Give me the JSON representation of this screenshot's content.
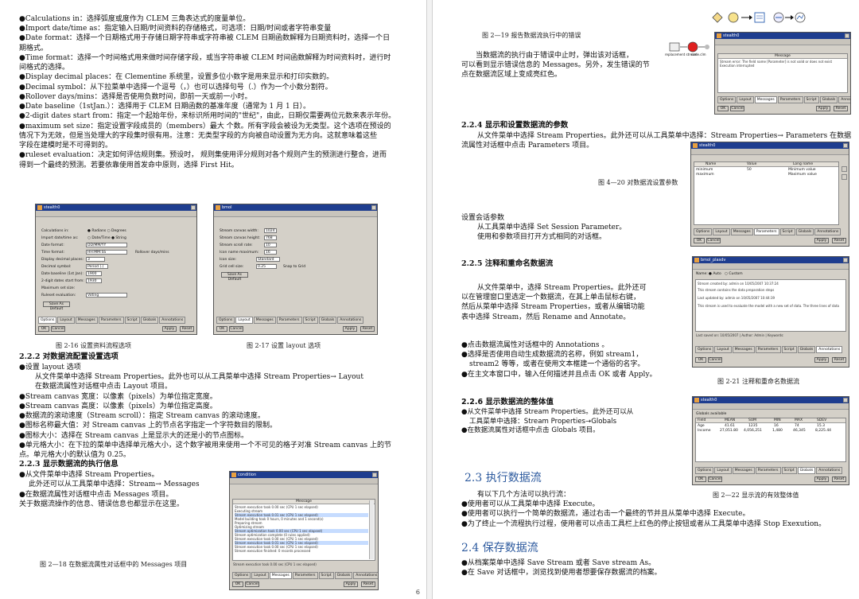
{
  "left_page": {
    "lines": [
      "●Calculations in：选择弧度或度作为 CLEM 三角表达式的度量单位。",
      "●Import date/time as：指定输入日期/时间资料的存储格式，可选项：日期/时间或者字符串变量",
      "●Date format：选择一个日期格式用于存储日期字符串或字符串被 CLEM 日期函数解释为日期资料时，选择一个日",
      "期格式。",
      "●Time format：选择一个时间格式用来做时间存储字段，或当字符串被 CLEM 时间函数解释为时间资料时，进行时",
      "间格式的选择。",
      "●Display decimal places：在 Clementine 系统里，设置多位小数字是用来显示和打印实数的。",
      "●Decimal symbol：从下拉菜单中选择一个逗号（，）也可以选择句号（.）作为一个小数分割符。",
      "●Rollover days/mins：选择是否使用负数时间，即前一天或前一小时。",
      "●Date baseline（1stJan.）：选择用于 CLEM 日期函数的基准年度（通常为 1 月 1 日）。",
      "●2-digit dates start from：指定一个起始年份，来标识所用时间的\"世纪\"，由此，日期仅需要两位元数来表示年份。",
      "●maximum set size：指定设置字段成员的（members）最大 个数。所有字段会被设为无类型。这个选项在预设的",
      "情况下为无效，但是当处理大的字段集时很有用。注意：无类型字段的方向被自动设置为无方向。这就意味着这些",
      "字段在建模时是不可得到的。",
      "●ruleset evaluation：决定如何评估规则集。预设时，     规则集使用评分规则对各个规则产生的预测进行整合，进而",
      "得到一个最终的预测。若要依靠使用首发命中原则，选择 First Hit。"
    ],
    "fig216_caption": "图 2-16    设置资料流程选项",
    "fig217_caption": "图 2-17   设置 layout 选项",
    "section_lines": [
      {
        "text": "2.2.2 对数据流配置设置选项",
        "cls": "heading"
      },
      {
        "text": "●设置 layout 选项",
        "cls": ""
      },
      {
        "text": "从文件菜单中选择 Stream Properties。此外也可以从工具菜单中选择 Stream Properties→ Layout",
        "cls": "indent"
      },
      {
        "text": "在数据流属性对话框中点击 Layout 项目。",
        "cls": "indent"
      },
      {
        "text": "●Stream canvas 宽度：以像素（pixels）为单位指定宽度。",
        "cls": ""
      },
      {
        "text": "●Stream canvas 高度：以像素（pixels）为单位指定高度。",
        "cls": ""
      },
      {
        "text": "●数据流的滚动速度（Stream scroll）：指定 Stream canvas 的滚动速度。",
        "cls": ""
      },
      {
        "text": "●图标名称最大值：对 Stream canvas 上的节点名字指定一个字符数目的限制。",
        "cls": ""
      },
      {
        "text": "●图标大小：选择在 Stream canvas 上是显示大的还是小的节点图标。",
        "cls": ""
      },
      {
        "text": "●单元格大小：在下拉的菜单中选择单元格大小，这个数字被用来使用一个不可见的格子对准 Stream canvas 上的节",
        "cls": ""
      },
      {
        "text": "点。单元格大小的默认值为 0.25。",
        "cls": ""
      },
      {
        "text": "2.2.3 显示数据流的执行信息",
        "cls": "heading"
      },
      {
        "text": "●从文件菜单中选择 Stream Properties。",
        "cls": ""
      },
      {
        "text": "此外还可以从工具菜单中选择：Stream→ Messages",
        "cls": "indent-small"
      },
      {
        "text": "●在数据流属性对话框中点击 Messages 项目。",
        "cls": ""
      },
      {
        "text": "关于数据流操作的信息、错误信息也都显示在这里。",
        "cls": ""
      }
    ],
    "fig218_caption": "图 2—18    在数据流属性对话框中的 Messages 项目",
    "page_number": "6"
  },
  "right_page": {
    "fig219_caption": "图 2—19    报告数据流执行中的错误",
    "error_para": [
      "当数据流的执行由于错误中止时，弹出该对话框，",
      "可以看到显示错误信息的 Messages。另外，发生错误的节",
      "点在数据流区域上变成亮红色。"
    ],
    "sec224_heading": "2.2.4 显示和设置数据流的参数",
    "sec224_lines": [
      "从文件菜单中选择 Stream Properties。此外还可以从工具菜单中选择：Stream Properties→  Parameters     在数据",
      "流属性对话框中点击 Parameters 项目。"
    ],
    "fig220_caption": "图 4—20   对数据流设置参数",
    "session_lines": [
      "设置会话参数",
      "从工具菜单中选择 Set Session Parameter。",
      "使用和参数项目打开方式相同的对话框。"
    ],
    "sec225_heading": "2.2.5 注释和重命名数据流",
    "sec225_lines": [
      "从文件菜单中，选择 Stream Properties。此外还可",
      "以在管理窗口里选定一个数据流，在其上单击鼠标右键，",
      "然后从菜单中选择 Stream Properties，或者从编辑功能",
      "表中选择 Stream，然后 Rename and Annotate。"
    ],
    "sec225_bullets": [
      "●点击数据流属性对话框中的 Annotations 。",
      "●选择是否使用自动生成数据流的名称，例如    stream1，",
      "stream2 等等，或者在使用文本框建一个通俗的名字。",
      "●在主文本窗口中，输入任何描述并且点击 OK 或者 Apply。"
    ],
    "fig221_caption": "图 2-21 注释和重命名数据流",
    "sec226_heading": "2.2.6 显示数据流的整体值",
    "sec226_lines": [
      "●从文件菜单中选择 Stream Properties。此外还可以从",
      "工具菜单中选择：Stream Properties→Globals",
      "●在数据流属性对话框中点击 Globals 项目。"
    ],
    "sec23_heading": "2.3   执行数据流",
    "sec23_lines": [
      "有以下几个方法可以执行流：",
      "●使用者可以从工具菜单中选择 Execute。",
      "●使用者可以执行一个简单的数据流，通过右击一个最终的节并且从菜单中选择 Execute。",
      "●为了终止一个流程执行过程，使用者可以点击工具栏上红色的停止按钮或者从工具菜单中选择 Stop Exexution。"
    ],
    "fig222_caption": "图 2—22   显示流的有效整体值",
    "sec24_heading": "2.4   保存数据流",
    "sec24_lines": [
      "●从档案菜单中选择 Save Stream 或者 Save stream As。",
      "●在 Save 对话框中，浏览找到使用者想要保存数据流的档案。"
    ]
  },
  "dialogs": {
    "fig216": {
      "title": "stealth0",
      "rows": [
        "Calculations in:",
        "Import date/time as:",
        "Date format:",
        "Time format:",
        "Display decimal places:",
        "Decimal symbol:",
        "Date baseline (1st Jan):",
        "2-digit dates start from:",
        "Maximum set size:",
        "Ruleset evaluation:",
        "Save As Default"
      ],
      "values": [
        "● Radians   ○ Degrees",
        "○ Date/Time  ● String",
        "DD/MM/YY",
        "HH:MM:SS",
        "3",
        "Period (.)",
        "1900",
        "1930",
        "",
        "Voting",
        ""
      ],
      "rollover": "Rollover days/mins",
      "tabs": [
        "Options",
        "Layout",
        "Messages",
        "Parameters",
        "Script",
        "Globals",
        "Annotations"
      ],
      "ok": "OK",
      "cancel": "Cancel",
      "apply": "Apply",
      "reset": "Reset"
    },
    "fig217": {
      "title": "bmol",
      "rows": [
        "Stream canvas width:",
        "Stream canvas height:",
        "Stream scroll rate:",
        "Icon name maximum:",
        "Icon size:",
        "Grid cell size:",
        "Save As Default"
      ],
      "values": [
        "1024",
        "768",
        "10",
        "16",
        "Standard",
        "0.25",
        ""
      ],
      "snap": "Snap to Grid",
      "tabs": [
        "Options",
        "Layout",
        "Messages",
        "Parameters",
        "Script",
        "Globals",
        "Annotations"
      ],
      "ok": "OK",
      "cancel": "Cancel",
      "apply": "Apply",
      "reset": "Reset"
    },
    "fig218": {
      "title": "condition",
      "header": "Message",
      "messages": [
        "Stream execution took 0.00 sec (CPU 1 sec elapsed)",
        "Executing stream",
        "Stream execution took 0.01 sec (CPU 1 sec elapsed)",
        "Model building took 0 hours, 0 minutes and 1 second(s)",
        "Preparing stream",
        "Optimizing stream",
        "Stream optimization took 0.00 sec (CPU 1 sec elapsed)",
        "Stream optimization complete (0 rules applied)",
        "Stream execution took 0.00 sec (CPU 1 sec elapsed)",
        "Stream execution took 0.01 sec (CPU 1 sec elapsed)",
        "Stream execution took 0.00 sec (CPU 1 sec elapsed)",
        "Stream execution finished: 0 records processed"
      ],
      "status": "Stream execution took 0.00 sec (CPU 1 sec elapsed)",
      "tabs": [
        "Options",
        "Layout",
        "Messages",
        "Parameters",
        "Script",
        "Globals",
        "Annotations"
      ],
      "ok": "OK",
      "cancel": "Cancel",
      "apply": "Apply",
      "reset": "Reset"
    },
    "fig219": {
      "title": "stealth0",
      "header": "Message",
      "messages": [
        "Stream error: The field name [Parameter] is not valid or does not exist",
        "Execution interrupted"
      ],
      "tabs": [
        "Options",
        "Layout",
        "Messages",
        "Parameters",
        "Script",
        "Globals",
        "Annotations"
      ],
      "ok": "OK",
      "cancel": "Cancel",
      "apply": "Apply",
      "reset": "Reset",
      "node_label": "replacement stream",
      "node_label2": "node.clm"
    },
    "fig220": {
      "title": "stealth0",
      "columns": [
        "Name",
        "Value",
        "Long name"
      ],
      "rows": [
        [
          "minimum",
          "50",
          "Minimum value"
        ],
        [
          "maximum",
          "",
          "Maximum value"
        ]
      ],
      "tabs": [
        "Options",
        "Layout",
        "Messages",
        "Parameters",
        "Script",
        "Globals",
        "Annotations"
      ],
      "ok": "OK",
      "cancel": "Cancel",
      "apply": "Apply",
      "reset": "Reset"
    },
    "fig221": {
      "title": "bmol_plasdv",
      "name_label": "Name:",
      "auto": "● Auto",
      "custom": "○ Custom",
      "body_lines": [
        "Stream created by: admin on 10/05/2007 10:37:24",
        "This stream contains the data preparation steps",
        "Last updated by: admin on 10/05/2007 10:44:39",
        "This stream is used to evaluate the model with a new set of data. The three lines of data were imported from source files."
      ],
      "footer": "Last saved on: 10/05/2007 | Author: Admin | Keywords:",
      "tabs": [
        "Options",
        "Layout",
        "Messages",
        "Parameters",
        "Script",
        "Globals",
        "Annotations"
      ],
      "ok": "OK",
      "cancel": "Cancel",
      "apply": "Apply",
      "reset": "Reset"
    },
    "fig222": {
      "title": "stealth0",
      "subtitle": "Globals available",
      "columns": [
        "Field",
        "MEAN",
        "SUM",
        "MIN",
        "MAX",
        "SDEV"
      ],
      "rows": [
        [
          "Age",
          "41.61",
          "1235",
          "16",
          "74",
          "15.3"
        ],
        [
          "Income",
          "27,051.80",
          "4,056,251",
          "1,480",
          "46,345",
          "8,225.44"
        ]
      ],
      "tabs": [
        "Options",
        "Layout",
        "Messages",
        "Parameters",
        "Script",
        "Globals",
        "Annotations"
      ],
      "ok": "OK",
      "cancel": "Cancel",
      "apply": "Apply",
      "reset": "Reset"
    }
  },
  "colors": {
    "title_bar": "#1e3d8f",
    "section_blue": "#2d5a9e",
    "error_red": "#e02020"
  }
}
